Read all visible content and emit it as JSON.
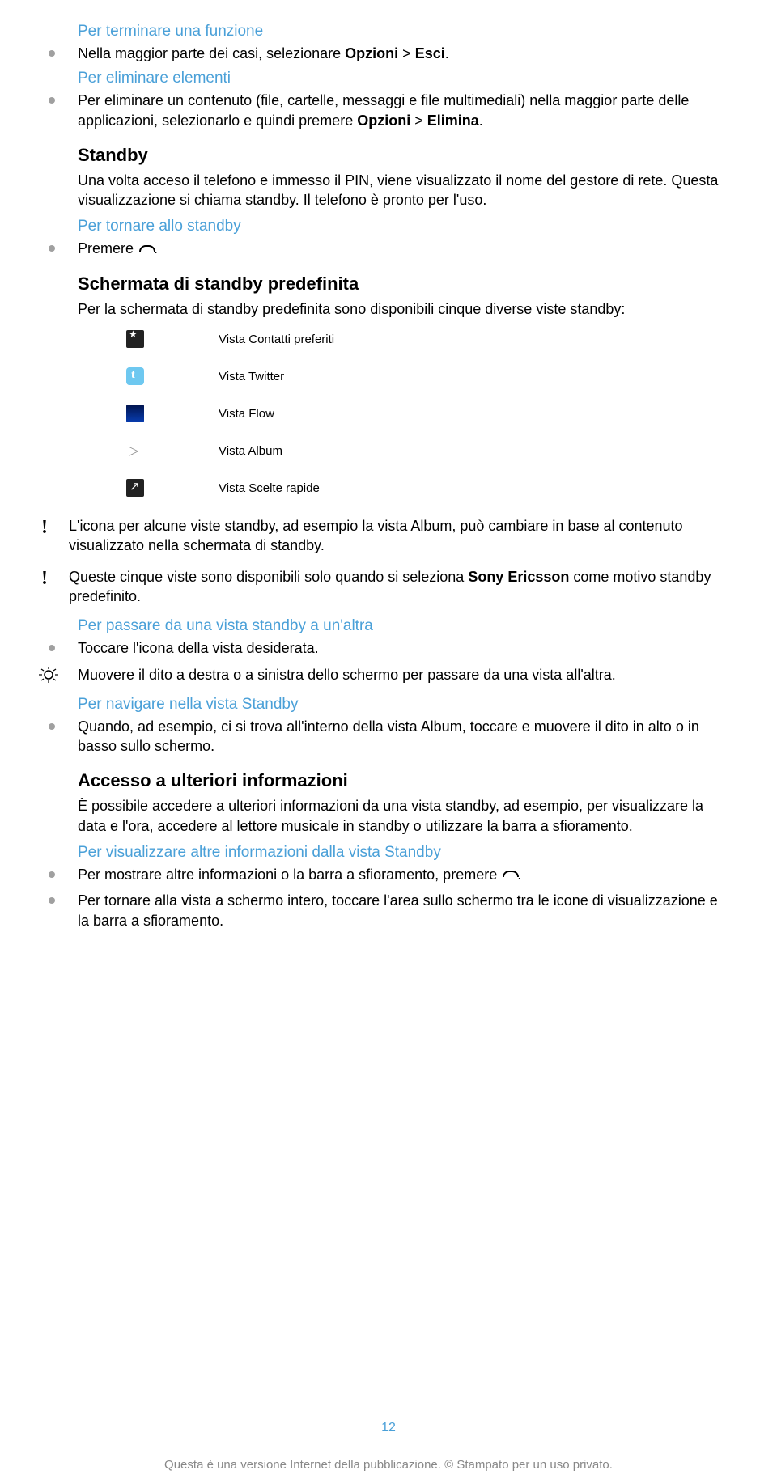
{
  "sections": {
    "terminate_func": {
      "title": "Per terminare una funzione",
      "bullet1_a": "Nella maggior parte dei casi, selezionare ",
      "bullet1_b": "Opzioni",
      "bullet1_c": " > ",
      "bullet1_d": "Esci",
      "bullet1_e": "."
    },
    "delete_elements": {
      "title": "Per eliminare elementi",
      "bullet1_a": "Per eliminare un contenuto (file, cartelle, messaggi e file multimediali) nella maggior parte delle applicazioni, selezionarlo e quindi premere ",
      "bullet1_b": "Opzioni",
      "bullet1_c": " > ",
      "bullet1_d": "Elimina",
      "bullet1_e": "."
    },
    "standby": {
      "title": "Standby",
      "body": "Una volta acceso il telefono e immesso il PIN, viene visualizzato il nome del gestore di rete. Questa visualizzazione si chiama standby. Il telefono è pronto per l'uso."
    },
    "return_standby": {
      "title": "Per tornare allo standby",
      "bullet1_a": "Premere ",
      "bullet1_b": "."
    },
    "default_standby": {
      "title": "Schermata di standby predefinita",
      "body": "Per la schermata di standby predefinita sono disponibili cinque diverse viste standby:",
      "vista": {
        "contacts": "Vista Contatti preferiti",
        "twitter": "Vista Twitter",
        "flow": "Vista Flow",
        "album": "Vista Album",
        "rapide": "Vista Scelte rapide"
      }
    },
    "note1": "L'icona per alcune viste standby, ad esempio la vista Album, può cambiare in base al contenuto visualizzato nella schermata di standby.",
    "note2_a": "Queste cinque viste sono disponibili solo quando si seleziona ",
    "note2_b": "Sony Ericsson",
    "note2_c": " come motivo standby predefinito.",
    "switch_view": {
      "title": "Per passare da una vista standby a un'altra",
      "bullet1": "Toccare l'icona della vista desiderata.",
      "tip": "Muovere il dito a destra o a sinistra dello schermo per passare da una vista all'altra."
    },
    "navigate_view": {
      "title": "Per navigare nella vista Standby",
      "bullet1": "Quando, ad esempio, ci si trova all'interno della vista Album, toccare e muovere il dito in alto o in basso sullo schermo."
    },
    "more_info": {
      "title": "Accesso a ulteriori informazioni",
      "body": "È possibile accedere a ulteriori informazioni da una vista standby, ad esempio, per visualizzare la data e l'ora, accedere al lettore musicale in standby o utilizzare la barra a sfioramento."
    },
    "view_more_info": {
      "title": "Per visualizzare altre informazioni dalla vista Standby",
      "bullet1_a": "Per mostrare altre informazioni o la barra a sfioramento, premere ",
      "bullet1_b": ".",
      "bullet2": "Per tornare alla vista a schermo intero, toccare l'area sullo schermo tra le icone di visualizzazione e la barra a sfioramento."
    }
  },
  "footer": {
    "page_number": "12",
    "line": "Questa è una versione Internet della pubblicazione. © Stampato per un uso privato."
  }
}
